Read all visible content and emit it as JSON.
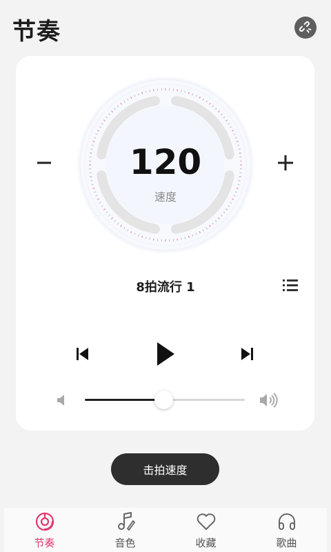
{
  "header": {
    "title": "节奏",
    "link_icon": "unlink-icon"
  },
  "tempo": {
    "value": "120",
    "label": "速度"
  },
  "pattern": {
    "name": "8拍流行 1"
  },
  "volume": {
    "level_percent": 49
  },
  "tap_button": {
    "label": "击拍速度"
  },
  "tabs": [
    {
      "label": "节奏",
      "icon": "metronome-icon",
      "active": true
    },
    {
      "label": "音色",
      "icon": "music-note-icon",
      "active": false
    },
    {
      "label": "收藏",
      "icon": "heart-icon",
      "active": false
    },
    {
      "label": "歌曲",
      "icon": "headphones-icon",
      "active": false
    }
  ],
  "colors": {
    "accent": "#e0386f",
    "dark": "#2e2e2e",
    "ring": "#e4e4e4"
  }
}
